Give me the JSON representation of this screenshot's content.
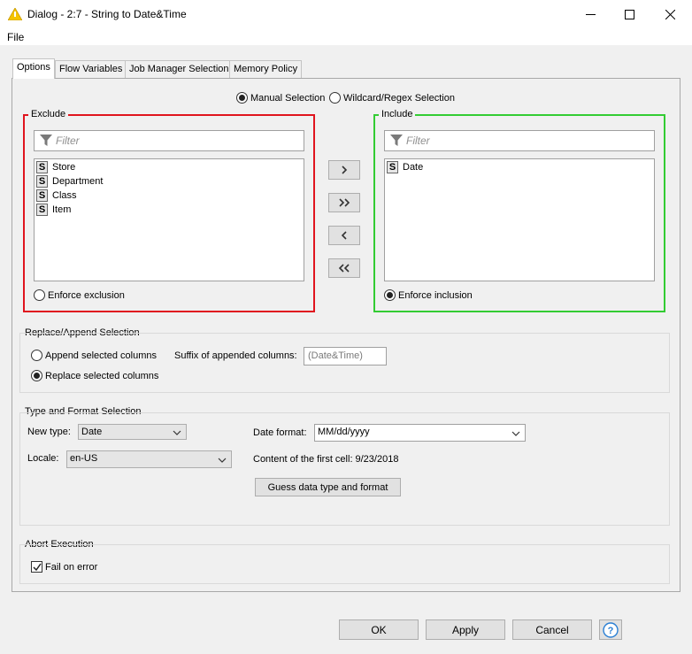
{
  "window": {
    "title": "Dialog - 2:7 - String to Date&Time",
    "icon": "knime-warning-triangle-icon",
    "controls": [
      "minimize-icon",
      "maximize-icon",
      "close-icon"
    ]
  },
  "menu": {
    "file": "File"
  },
  "tabs": [
    {
      "label": "Options",
      "active": true
    },
    {
      "label": "Flow Variables"
    },
    {
      "label": "Job Manager Selection"
    },
    {
      "label": "Memory Policy"
    }
  ],
  "selection_mode": {
    "manual": "Manual Selection",
    "wildcard": "Wildcard/Regex Selection",
    "selected": "manual"
  },
  "exclude": {
    "title": "Exclude",
    "filter_placeholder": "Filter",
    "items": [
      "Store",
      "Department",
      "Class",
      "Item"
    ],
    "type_badge": "S",
    "enforce_label": "Enforce exclusion",
    "enforce_selected": false,
    "border_color": "#e0141e"
  },
  "include": {
    "title": "Include",
    "filter_placeholder": "Filter",
    "items": [
      "Date"
    ],
    "type_badge": "S",
    "enforce_label": "Enforce inclusion",
    "enforce_selected": true,
    "border_color": "#33cc33"
  },
  "move_buttons": [
    {
      "glyph": ">",
      "name": "move-right-button"
    },
    {
      "glyph": "»",
      "name": "move-all-right-button"
    },
    {
      "glyph": "<",
      "name": "move-left-button"
    },
    {
      "glyph": "«",
      "name": "move-all-left-button"
    }
  ],
  "replace_append": {
    "title": "Replace/Append Selection",
    "append_label": "Append selected columns",
    "replace_label": "Replace selected columns",
    "selected": "replace",
    "suffix_label": "Suffix of appended columns:",
    "suffix_placeholder": "(Date&Time)"
  },
  "type_format": {
    "title": "Type and Format Selection",
    "new_type_label": "New type:",
    "new_type_value": "Date",
    "date_format_label": "Date format:",
    "date_format_value": "MM/dd/yyyy",
    "locale_label": "Locale:",
    "locale_value": "en-US",
    "first_cell_label": "Content of the first cell:",
    "first_cell_value": "9/23/2018",
    "guess_button": "Guess data type and format"
  },
  "abort": {
    "title": "Abort Execution",
    "fail_label": "Fail on error",
    "fail_checked": true
  },
  "footer": {
    "ok": "OK",
    "apply": "Apply",
    "cancel": "Cancel",
    "help_icon": "question-mark-icon"
  }
}
